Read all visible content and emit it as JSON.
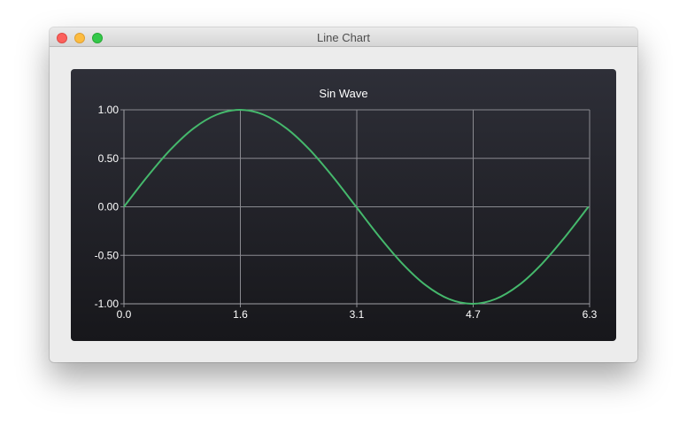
{
  "window": {
    "title": "Line Chart",
    "controls": [
      "close",
      "minimize",
      "zoom"
    ]
  },
  "chart_data": {
    "type": "line",
    "title": "Sin Wave",
    "xlabel": "",
    "ylabel": "",
    "xlim": [
      0,
      6.3
    ],
    "ylim": [
      -1,
      1
    ],
    "x_ticks": [
      "0.0",
      "1.6",
      "3.1",
      "4.7",
      "6.3"
    ],
    "y_ticks": [
      "1.00",
      "0.50",
      "0.00",
      "-0.50",
      "-1.00"
    ],
    "grid": true,
    "legend": "none",
    "series": [
      {
        "color": "#45b86c",
        "x": [
          0,
          0.314,
          0.628,
          0.942,
          1.257,
          1.571,
          1.885,
          2.199,
          2.513,
          2.827,
          3.142,
          3.456,
          3.77,
          4.084,
          4.398,
          4.712,
          5.027,
          5.341,
          5.655,
          5.969,
          6.283
        ],
        "y": [
          0,
          0.309,
          0.588,
          0.809,
          0.951,
          1,
          0.951,
          0.809,
          0.588,
          0.309,
          0,
          -0.309,
          -0.588,
          -0.809,
          -0.951,
          -1,
          -0.951,
          -0.809,
          -0.588,
          -0.309,
          0
        ]
      }
    ]
  },
  "colors": {
    "background_top": "#2e2f38",
    "background_bottom": "#17171b",
    "grid": "#8a8a90",
    "text": "#ffffff",
    "line": "#45b86c"
  }
}
